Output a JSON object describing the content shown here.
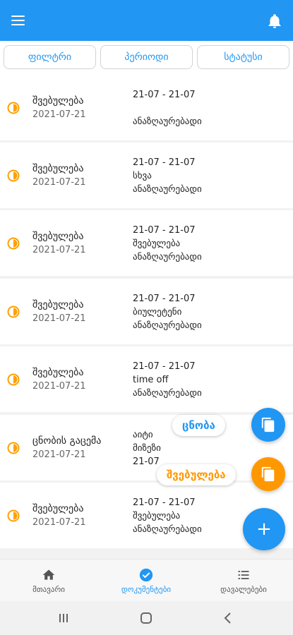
{
  "colors": {
    "primary": "#2196F3",
    "accent": "#FF9800",
    "status_icon": "#FFA000"
  },
  "appbar": {
    "menu_icon": "menu-icon",
    "bell_icon": "bell-icon"
  },
  "filters": [
    "ფილტრი",
    "პერიოდი",
    "სტატუსი"
  ],
  "rows": [
    {
      "title": "შვებულება",
      "date": "2021-07-21",
      "range": "21-07 - 21-07",
      "reason": "",
      "status": "ანაზღაურებადი"
    },
    {
      "title": "შვებულება",
      "date": "2021-07-21",
      "range": "21-07 - 21-07",
      "reason": "სხვა",
      "status": "ანაზღაურებადი"
    },
    {
      "title": "შვებულება",
      "date": "2021-07-21",
      "range": "21-07 - 21-07",
      "reason": "შვებულება",
      "status": "ანაზღაურებადი"
    },
    {
      "title": "შვებულება",
      "date": "2021-07-21",
      "range": "21-07 - 21-07",
      "reason": "ბიულეტენი",
      "status": "ანაზღაურებადი"
    },
    {
      "title": "შვებულება",
      "date": "2021-07-21",
      "range": "21-07 - 21-07",
      "reason": "time off",
      "status": "ანაზღაურებადი"
    },
    {
      "title": "ცნობის გაცემა",
      "date": "2021-07-21",
      "range": "აიტი",
      "reason": "მიზეზი",
      "status": "21-07"
    },
    {
      "title": "შვებულება",
      "date": "2021-07-21",
      "range": "21-07 - 21-07",
      "reason": "შვებულება",
      "status": "ანაზღაურებადი"
    }
  ],
  "fab_menu": {
    "certificate_label": "ცნობა",
    "leave_label": "შვებულება",
    "add_symbol": "+"
  },
  "bottom_nav": [
    {
      "label": "მთავარი",
      "icon": "home-icon",
      "active": false
    },
    {
      "label": "დოკუმენტები",
      "icon": "check-circle-icon",
      "active": true
    },
    {
      "label": "დავალებები",
      "icon": "list-icon",
      "active": false
    }
  ]
}
